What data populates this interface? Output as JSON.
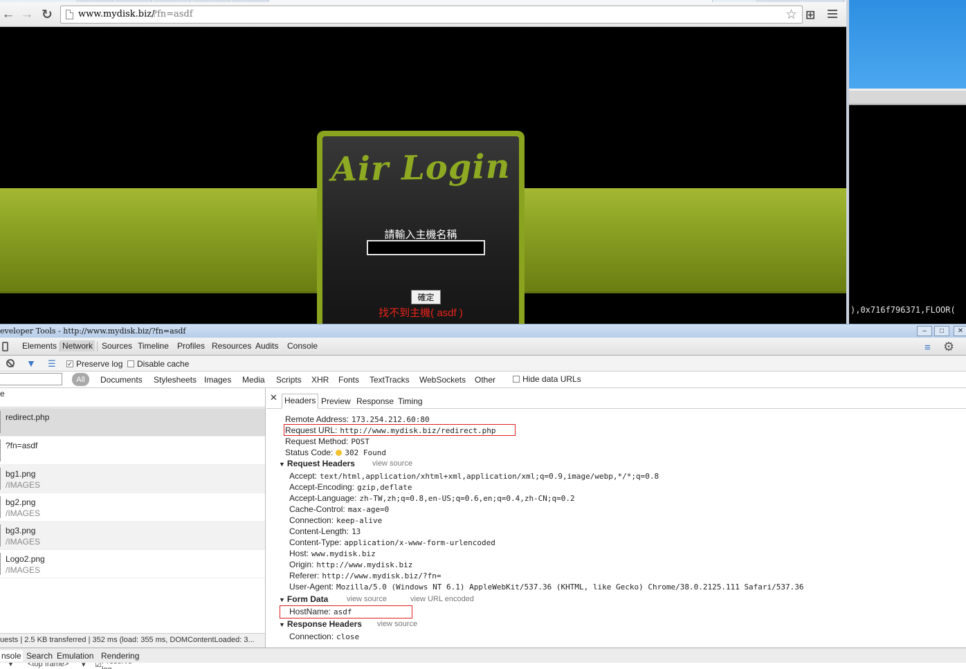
{
  "browser": {
    "url_host": "www.mydisk.biz/",
    "url_path": "?fn=asdf"
  },
  "page": {
    "login_title": "Air Login",
    "host_label": "請輸入主機名稱",
    "host_input_value": "",
    "ok_button": "確定",
    "error_text": "找不到主機( asdf )"
  },
  "side_window": {
    "text": "),0x716f796371,FLOOR("
  },
  "devtools": {
    "title": "eveloper Tools - http://www.mydisk.biz/?fn=asdf",
    "tabs": [
      "Elements",
      "Network",
      "Sources",
      "Timeline",
      "Profiles",
      "Resources",
      "Audits",
      "Console"
    ],
    "active_tab": "Network",
    "toolbar": {
      "preserve_log": "Preserve log",
      "disable_cache": "Disable cache",
      "hide_data_urls": "Hide data URLs"
    },
    "type_filters": [
      "All",
      "Documents",
      "Stylesheets",
      "Images",
      "Media",
      "Scripts",
      "XHR",
      "Fonts",
      "TextTracks",
      "WebSockets",
      "Other"
    ],
    "list_header": "e",
    "requests": [
      {
        "name": "redirect.php",
        "path": ""
      },
      {
        "name": "?fn=asdf",
        "path": ""
      },
      {
        "name": "bg1.png",
        "path": "/IMAGES"
      },
      {
        "name": "bg2.png",
        "path": "/IMAGES"
      },
      {
        "name": "bg3.png",
        "path": "/IMAGES"
      },
      {
        "name": "Logo2.png",
        "path": "/IMAGES"
      }
    ],
    "status_bar": "uests | 2.5 KB transferred | 352 ms (load: 355 ms, DOMContentLoaded: 3...",
    "detail_tabs": [
      "Headers",
      "Preview",
      "Response",
      "Timing"
    ],
    "general": {
      "remote_address": {
        "key": "Remote Address:",
        "value": "173.254.212.60:80"
      },
      "request_url": {
        "key": "Request URL:",
        "value": "http://www.mydisk.biz/redirect.php"
      },
      "request_method": {
        "key": "Request Method:",
        "value": "POST"
      },
      "status_code": {
        "key": "Status Code:",
        "value": "302 Found"
      }
    },
    "request_headers_title": "Request Headers",
    "view_source": "view source",
    "view_url_encoded": "view URL encoded",
    "request_headers": [
      {
        "key": "Accept:",
        "value": "text/html,application/xhtml+xml,application/xml;q=0.9,image/webp,*/*;q=0.8"
      },
      {
        "key": "Accept-Encoding:",
        "value": "gzip,deflate"
      },
      {
        "key": "Accept-Language:",
        "value": "zh-TW,zh;q=0.8,en-US;q=0.6,en;q=0.4,zh-CN;q=0.2"
      },
      {
        "key": "Cache-Control:",
        "value": "max-age=0"
      },
      {
        "key": "Connection:",
        "value": "keep-alive"
      },
      {
        "key": "Content-Length:",
        "value": "13"
      },
      {
        "key": "Content-Type:",
        "value": "application/x-www-form-urlencoded"
      },
      {
        "key": "Host:",
        "value": "www.mydisk.biz"
      },
      {
        "key": "Origin:",
        "value": "http://www.mydisk.biz"
      },
      {
        "key": "Referer:",
        "value": "http://www.mydisk.biz/?fn="
      },
      {
        "key": "User-Agent:",
        "value": "Mozilla/5.0 (Windows NT 6.1) AppleWebKit/537.36 (KHTML, like Gecko) Chrome/38.0.2125.111 Safari/537.36"
      }
    ],
    "form_data_title": "Form Data",
    "form_data": {
      "key": "HostName:",
      "value": "asdf"
    },
    "response_headers_title": "Response Headers",
    "response_headers": [
      {
        "key": "Connection:",
        "value": "close"
      }
    ],
    "drawer_tabs": [
      "nsole",
      "Search",
      "Emulation",
      "Rendering"
    ],
    "console_bar": {
      "frame": "<top frame>",
      "preserve_log": "Preserve log"
    }
  }
}
